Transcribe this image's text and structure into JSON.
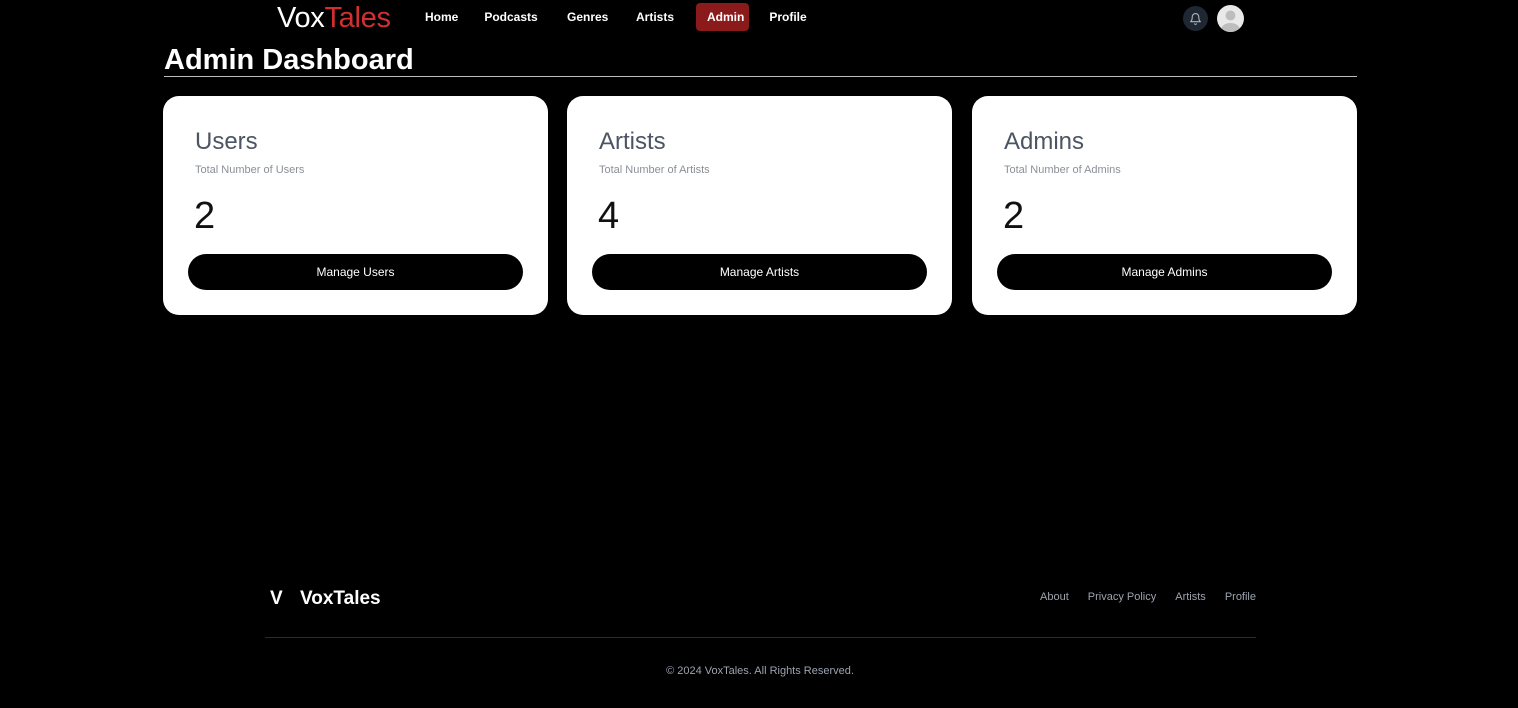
{
  "brand": {
    "part1": "Vox",
    "part2": "Tales"
  },
  "nav": {
    "home": "Home",
    "podcasts": "Podcasts",
    "genres": "Genres",
    "artists": "Artists",
    "admin": "Admin",
    "profile": "Profile",
    "active": "Admin",
    "active_color": "#8b1a1a"
  },
  "header_icons": {
    "notifications": "bell-icon",
    "user": "avatar-icon"
  },
  "page": {
    "title": "Admin Dashboard"
  },
  "cards": [
    {
      "title": "Users",
      "subtitle": "Total Number of Users",
      "count": "2",
      "button": "Manage Users"
    },
    {
      "title": "Artists",
      "subtitle": "Total Number of Artists",
      "count": "4",
      "button": "Manage Artists"
    },
    {
      "title": "Admins",
      "subtitle": "Total Number of Admins",
      "count": "2",
      "button": "Manage Admins"
    }
  ],
  "footer": {
    "logo_mark": "V",
    "brand": "VoxTales",
    "links": [
      "About",
      "Privacy Policy",
      "Artists",
      "Profile"
    ],
    "copyright": "© 2024 VoxTales. All Rights Reserved."
  },
  "colors": {
    "background": "#000000",
    "brand_accent": "#d32f2f",
    "card": "#ffffff"
  }
}
